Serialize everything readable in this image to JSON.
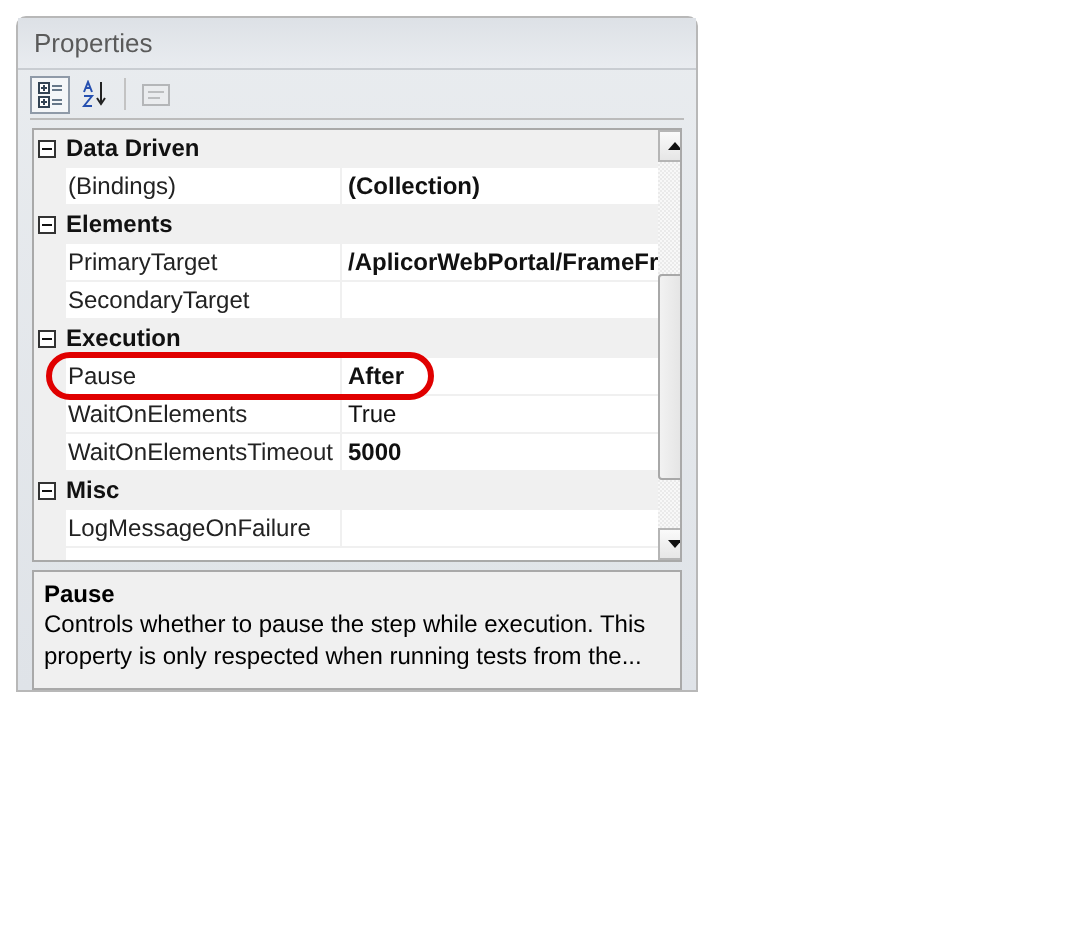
{
  "panel": {
    "title": "Properties"
  },
  "toolbar": [
    {
      "kind": "categorized",
      "selected": true,
      "disabled": false
    },
    {
      "kind": "alphabetical",
      "selected": false,
      "disabled": false
    },
    {
      "kind": "property-pages",
      "selected": false,
      "disabled": true
    }
  ],
  "categories": [
    {
      "name": "Data Driven",
      "expanded": true,
      "properties": [
        {
          "name": "(Bindings)",
          "value": "(Collection)",
          "modified": true,
          "highlighted": false
        }
      ]
    },
    {
      "name": "Elements",
      "expanded": true,
      "properties": [
        {
          "name": "PrimaryTarget",
          "value": "/AplicorWebPortal/FrameFr",
          "modified": true,
          "highlighted": false
        },
        {
          "name": "SecondaryTarget",
          "modified": false,
          "highlighted": false
        }
      ]
    },
    {
      "name": "Execution",
      "expanded": true,
      "properties": [
        {
          "name": "Pause",
          "value": "After",
          "modified": true,
          "highlighted": true
        },
        {
          "name": "WaitOnElements",
          "value": "True",
          "modified": false,
          "highlighted": false
        },
        {
          "name": "WaitOnElementsTimeout",
          "value": "5000",
          "modified": true,
          "highlighted": false
        }
      ]
    },
    {
      "name": "Misc",
      "expanded": true,
      "properties": [
        {
          "name": "LogMessageOnFailure",
          "modified": false,
          "highlighted": false
        }
      ]
    }
  ],
  "description": {
    "title": "Pause",
    "text": "Controls whether to pause the step while execution. This property is only respected when running tests from the..."
  }
}
